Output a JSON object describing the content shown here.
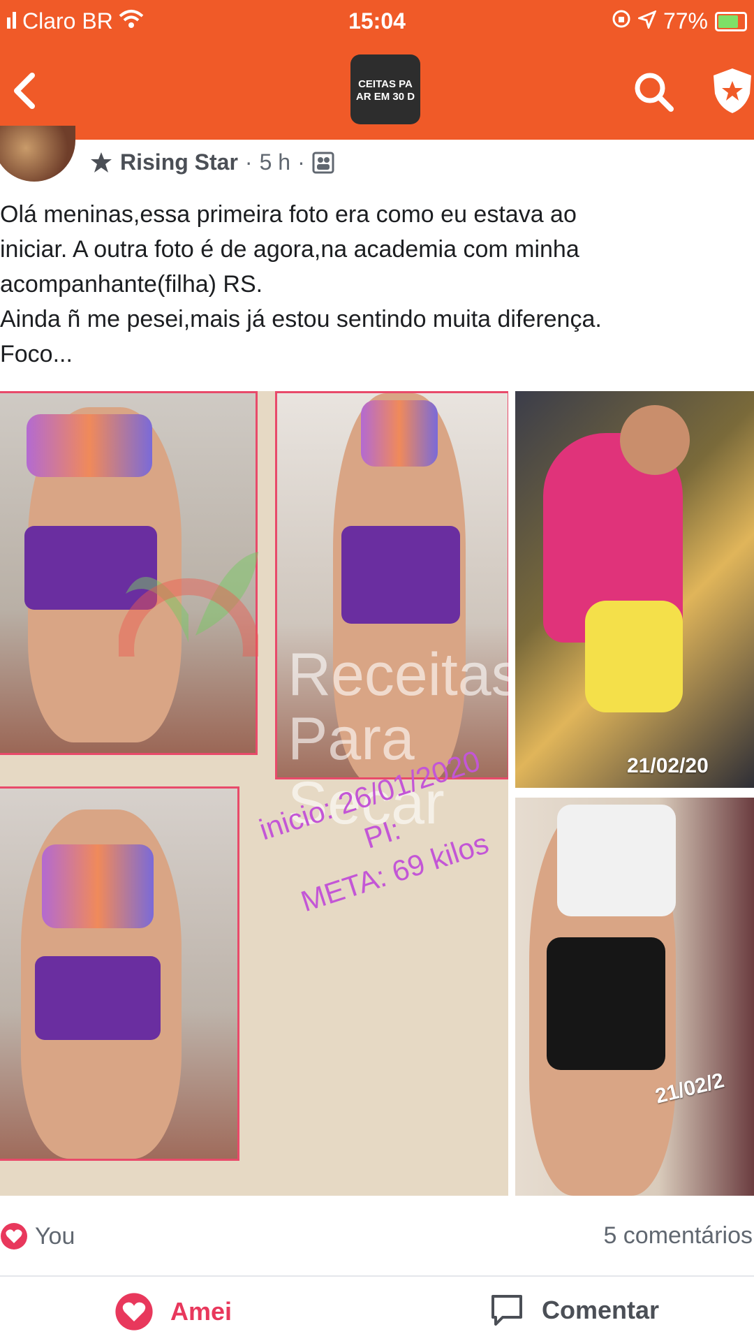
{
  "status_bar": {
    "carrier": "Claro BR",
    "time": "15:04",
    "battery": "77%"
  },
  "group": {
    "logo_line1": "CEITAS PA",
    "logo_line2": "AR EM 30 D"
  },
  "post": {
    "author_badge": "Rising Star",
    "time_ago": "5 h",
    "text_lines": [
      "Olá meninas,essa primeira foto era como eu estava ao",
      "iniciar.  A outra foto é de agora,na academia com minha",
      "acompanhante(filha) RS.",
      "Ainda ñ me pesei,mais já estou sentindo muita diferença.",
      "Foco..."
    ],
    "collage": {
      "watermark_line1": "Receitas",
      "watermark_line2": "Para Secar",
      "caption_line1": "inicio: 26/01/2020",
      "caption_line2": "PI:",
      "caption_line3": "META: 69 kilos"
    },
    "photo_dates": [
      "21/02/20",
      "21/02/2"
    ]
  },
  "reactions": {
    "who": "You",
    "comments": "5 comentários"
  },
  "actions": {
    "love_label": "Amei",
    "comment_label": "Comentar"
  },
  "colors": {
    "header": "#f05a28",
    "love": "#e8385c"
  }
}
